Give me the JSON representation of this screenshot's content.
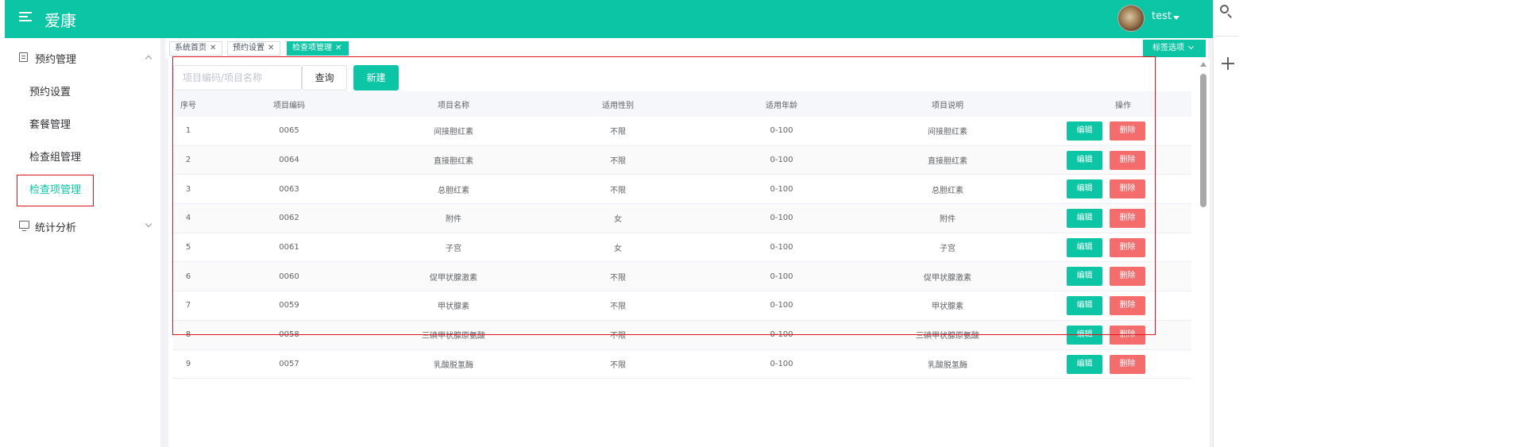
{
  "header": {
    "app_title": "爱康",
    "user_name": "test"
  },
  "sidebar": {
    "groups": [
      {
        "label": "预约管理",
        "expanded": true,
        "items": [
          {
            "label": "预约设置",
            "active": false
          },
          {
            "label": "套餐管理",
            "active": false
          },
          {
            "label": "检查组管理",
            "active": false
          },
          {
            "label": "检查项管理",
            "active": true
          }
        ]
      },
      {
        "label": "统计分析",
        "expanded": false,
        "items": []
      }
    ]
  },
  "tabs": [
    {
      "label": "系统首页",
      "active": false
    },
    {
      "label": "预约设置",
      "active": false
    },
    {
      "label": "检查项管理",
      "active": true
    }
  ],
  "tags_option_label": "标签选项",
  "toolbar": {
    "search_placeholder": "项目编码/项目名称",
    "search_value": "",
    "query_label": "查询",
    "new_label": "新建"
  },
  "table": {
    "columns": [
      "序号",
      "项目编码",
      "项目名称",
      "适用性别",
      "适用年龄",
      "项目说明",
      "操作"
    ],
    "edit_label": "编辑",
    "delete_label": "删除",
    "rows": [
      {
        "idx": "1",
        "code": "0065",
        "name": "间接胆红素",
        "sex": "不限",
        "age": "0-100",
        "desc": "间接胆红素"
      },
      {
        "idx": "2",
        "code": "0064",
        "name": "直接胆红素",
        "sex": "不限",
        "age": "0-100",
        "desc": "直接胆红素"
      },
      {
        "idx": "3",
        "code": "0063",
        "name": "总胆红素",
        "sex": "不限",
        "age": "0-100",
        "desc": "总胆红素"
      },
      {
        "idx": "4",
        "code": "0062",
        "name": "附件",
        "sex": "女",
        "age": "0-100",
        "desc": "附件"
      },
      {
        "idx": "5",
        "code": "0061",
        "name": "子宫",
        "sex": "女",
        "age": "0-100",
        "desc": "子宫"
      },
      {
        "idx": "6",
        "code": "0060",
        "name": "促甲状腺激素",
        "sex": "不限",
        "age": "0-100",
        "desc": "促甲状腺激素"
      },
      {
        "idx": "7",
        "code": "0059",
        "name": "甲状腺素",
        "sex": "不限",
        "age": "0-100",
        "desc": "甲状腺素"
      },
      {
        "idx": "8",
        "code": "0058",
        "name": "三碘甲状腺原氨酸",
        "sex": "不限",
        "age": "0-100",
        "desc": "三碘甲状腺原氨酸"
      },
      {
        "idx": "9",
        "code": "0057",
        "name": "乳酸脱氢酶",
        "sex": "不限",
        "age": "0-100",
        "desc": "乳酸脱氢酶"
      }
    ]
  },
  "colors": {
    "brand": "#0bc5a5",
    "danger": "#f56c6c",
    "highlight": "#e0141e"
  },
  "icons": {
    "header_menu": "hamburger-icon",
    "group1": "document-icon",
    "group2": "monitor-icon",
    "strip_search": "search-icon",
    "strip_add": "plus-icon"
  }
}
